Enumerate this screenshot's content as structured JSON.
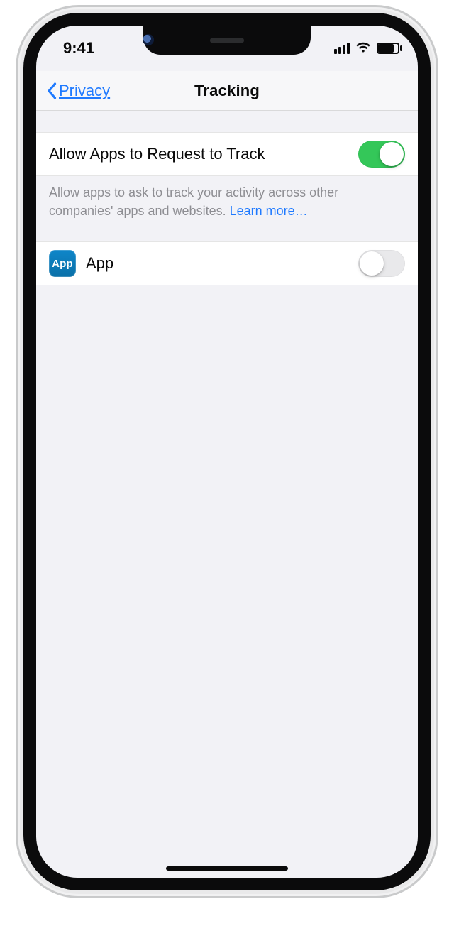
{
  "statusbar": {
    "time": "9:41"
  },
  "nav": {
    "back_label": "Privacy",
    "title": "Tracking"
  },
  "settings": {
    "allow_tracking": {
      "label": "Allow Apps to Request to Track",
      "on": true
    },
    "footer_text": "Allow apps to ask to track your activity across other companies' apps and websites. ",
    "learn_more_label": "Learn more…"
  },
  "apps": [
    {
      "icon_label": "App",
      "name": "App",
      "on": false
    }
  ]
}
